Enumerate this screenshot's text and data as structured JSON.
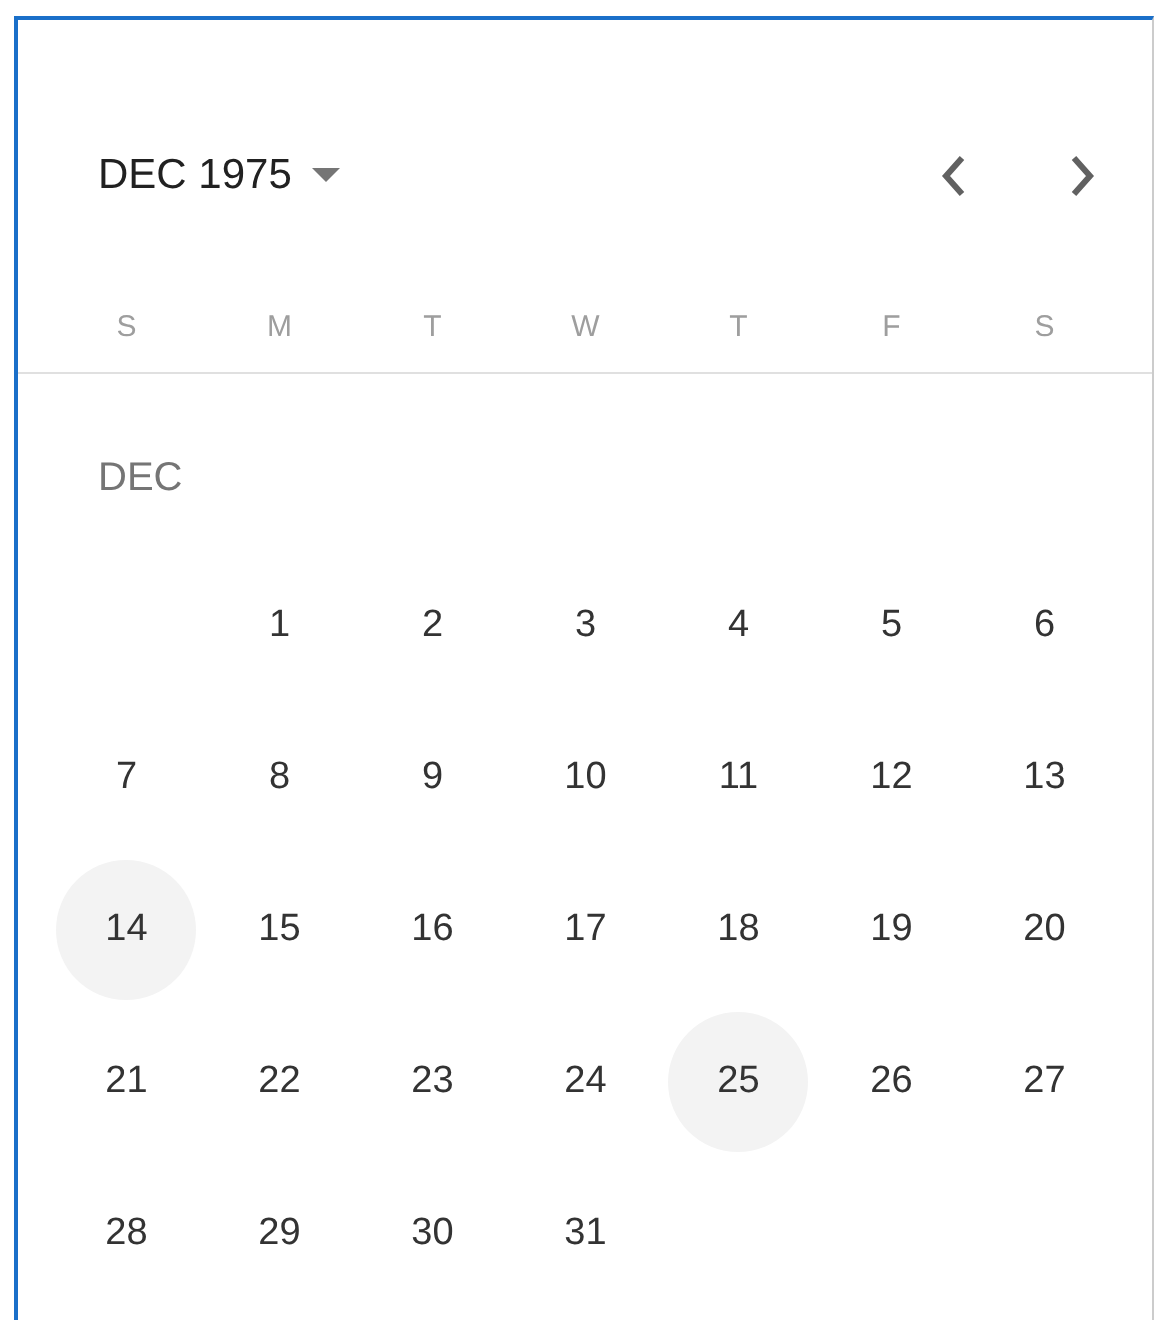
{
  "header": {
    "month_label": "DEC 1975"
  },
  "weekdays": [
    "S",
    "M",
    "T",
    "W",
    "T",
    "F",
    "S"
  ],
  "month_section": {
    "label": "DEC",
    "weeks": [
      {
        "days": [
          {
            "day": "1",
            "highlighted": false
          },
          {
            "day": "2",
            "highlighted": false
          },
          {
            "day": "3",
            "highlighted": false
          },
          {
            "day": "4",
            "highlighted": false
          },
          {
            "day": "5",
            "highlighted": false
          },
          {
            "day": "6",
            "highlighted": false
          }
        ]
      },
      {
        "days": [
          {
            "day": "7",
            "highlighted": false
          },
          {
            "day": "8",
            "highlighted": false
          },
          {
            "day": "9",
            "highlighted": false
          },
          {
            "day": "10",
            "highlighted": false
          },
          {
            "day": "11",
            "highlighted": false
          },
          {
            "day": "12",
            "highlighted": false
          },
          {
            "day": "13",
            "highlighted": false
          }
        ]
      },
      {
        "days": [
          {
            "day": "14",
            "highlighted": true
          },
          {
            "day": "15",
            "highlighted": false
          },
          {
            "day": "16",
            "highlighted": false
          },
          {
            "day": "17",
            "highlighted": false
          },
          {
            "day": "18",
            "highlighted": false
          },
          {
            "day": "19",
            "highlighted": false
          },
          {
            "day": "20",
            "highlighted": false
          }
        ]
      },
      {
        "days": [
          {
            "day": "21",
            "highlighted": false
          },
          {
            "day": "22",
            "highlighted": false
          },
          {
            "day": "23",
            "highlighted": false
          },
          {
            "day": "24",
            "highlighted": false
          },
          {
            "day": "25",
            "highlighted": true
          },
          {
            "day": "26",
            "highlighted": false
          },
          {
            "day": "27",
            "highlighted": false
          }
        ]
      },
      {
        "days": [
          {
            "day": "28",
            "highlighted": false
          },
          {
            "day": "29",
            "highlighted": false
          },
          {
            "day": "30",
            "highlighted": false
          },
          {
            "day": "31",
            "highlighted": false
          }
        ]
      }
    ]
  }
}
